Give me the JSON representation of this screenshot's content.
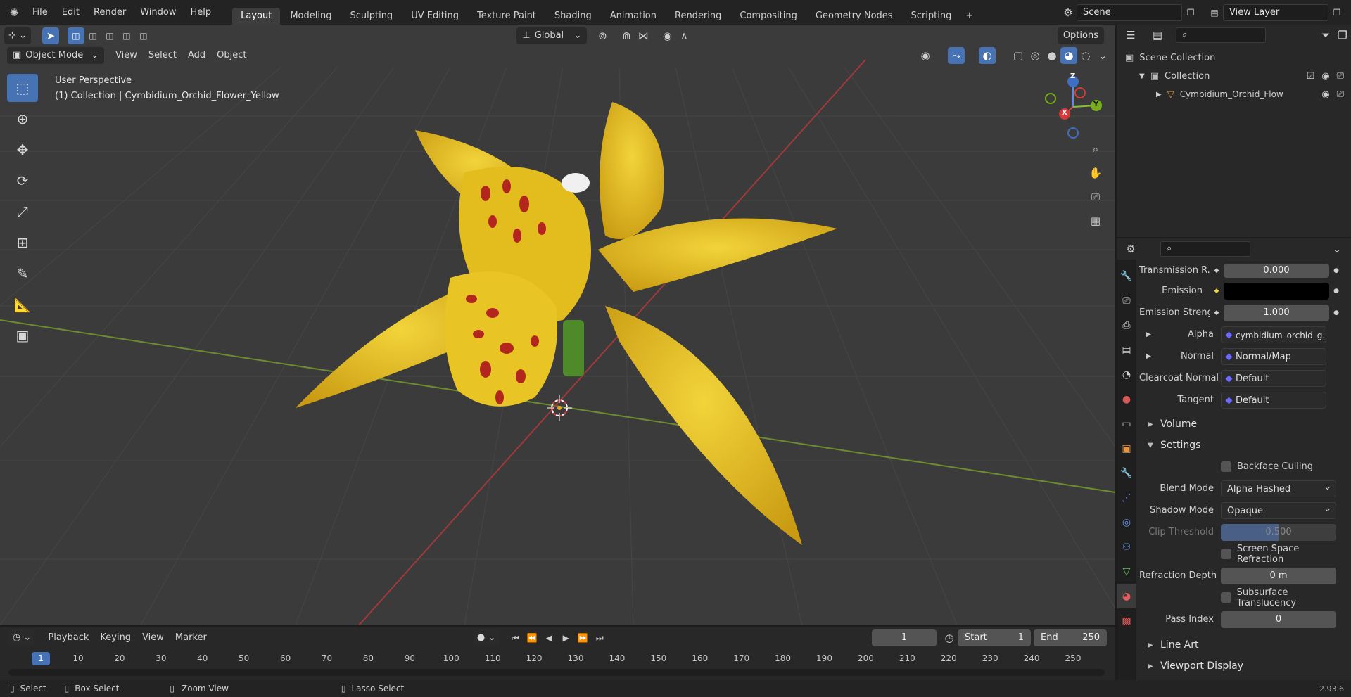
{
  "menu": [
    "File",
    "Edit",
    "Render",
    "Window",
    "Help"
  ],
  "workspaces": [
    "Layout",
    "Modeling",
    "Sculpting",
    "UV Editing",
    "Texture Paint",
    "Shading",
    "Animation",
    "Rendering",
    "Compositing",
    "Geometry Nodes",
    "Scripting"
  ],
  "active_workspace": "Layout",
  "scene": "Scene",
  "view_layer": "View Layer",
  "viewport": {
    "mode": "Object Mode",
    "menus": [
      "View",
      "Select",
      "Add",
      "Object"
    ],
    "transform_orientation": "Global",
    "options": "Options",
    "info_line1": "User Perspective",
    "info_line2": "(1) Collection | Cymbidium_Orchid_Flower_Yellow",
    "gizmo": {
      "x": "X",
      "y": "Y",
      "z": "Z"
    }
  },
  "outliner": {
    "root": "Scene Collection",
    "collection": "Collection",
    "object": "Cymbidium_Orchid_Flow"
  },
  "properties": {
    "rows": [
      {
        "label": "Transmission R...",
        "value": "0.000",
        "kind": "num"
      },
      {
        "label": "Emission",
        "value": "",
        "kind": "color"
      },
      {
        "label": "Emission Strengt",
        "value": "1.000",
        "kind": "num"
      },
      {
        "label": "Alpha",
        "value": "cymbidium_orchid_g...",
        "kind": "link",
        "expand": true
      },
      {
        "label": "Normal",
        "value": "Normal/Map",
        "kind": "link",
        "expand": true
      },
      {
        "label": "Clearcoat Normal",
        "value": "Default",
        "kind": "link"
      },
      {
        "label": "Tangent",
        "value": "Default",
        "kind": "link"
      }
    ],
    "volume": "Volume",
    "settings": "Settings",
    "backface": "Backface Culling",
    "blend_mode_label": "Blend Mode",
    "blend_mode": "Alpha Hashed",
    "shadow_mode_label": "Shadow Mode",
    "shadow_mode": "Opaque",
    "clip_label": "Clip Threshold",
    "clip_value": "0.500",
    "ssr": "Screen Space Refraction",
    "refraction_label": "Refraction Depth",
    "refraction_value": "0 m",
    "subsurface": "Subsurface Translucency",
    "pass_label": "Pass Index",
    "pass_value": "0",
    "line_art": "Line Art",
    "viewport_display": "Viewport Display"
  },
  "timeline": {
    "menus": [
      "Playback",
      "Keying",
      "View",
      "Marker"
    ],
    "current_frame": "1",
    "start_label": "Start",
    "start": "1",
    "end_label": "End",
    "end": "250",
    "ticks": [
      "1",
      "10",
      "20",
      "30",
      "40",
      "50",
      "60",
      "70",
      "80",
      "90",
      "100",
      "110",
      "120",
      "130",
      "140",
      "150",
      "160",
      "170",
      "180",
      "190",
      "200",
      "210",
      "220",
      "230",
      "240",
      "250"
    ]
  },
  "status": {
    "select": "Select",
    "box_select": "Box Select",
    "zoom": "Zoom View",
    "lasso": "Lasso Select",
    "version": "2.93.6"
  },
  "colors": {
    "accent": "#4772b3",
    "petal": "#e8c21f",
    "spots": "#b3261e",
    "stem": "#4f8a2a"
  }
}
